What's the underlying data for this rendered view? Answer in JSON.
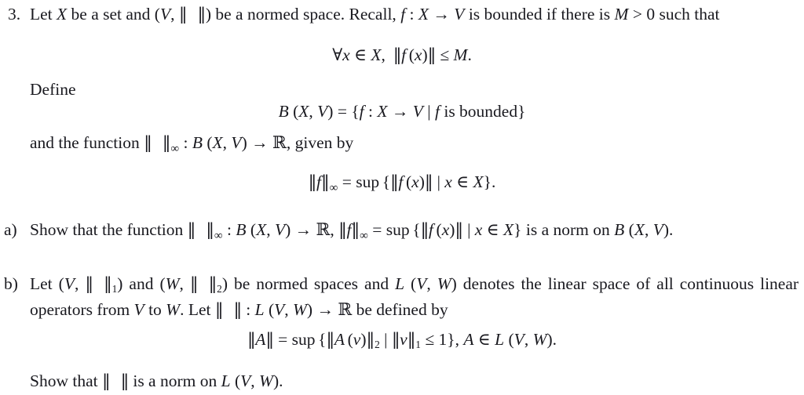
{
  "document": {
    "type": "math-exercise",
    "problem_number": "3.",
    "background_color": "#ffffff",
    "text_color": "#19191f"
  },
  "problem": {
    "marker": "3.",
    "intro": {
      "text_part_1": "Let ",
      "var_X": "X",
      "text_part_2": " be a set and (",
      "var_V": "V",
      "comma": ", ",
      "norm_open": "‖",
      "norm_close": "‖",
      "text_part_3": ") be a normed space. Recall, ",
      "var_f": "f",
      "colon": " : ",
      "domain": "X",
      "arrow": " → ",
      "codomain": "V",
      "text_part_4": " is bounded if there is ",
      "var_M": "M",
      "gt_zero": " > 0",
      "text_part_5": " such that"
    },
    "equation_1": {
      "forall": "∀",
      "var_x": "x",
      "in": " ∈ ",
      "set_X": "X",
      "comma": ",",
      "norm_open": "‖",
      "func": "f",
      "arg_open": "(",
      "arg": "x",
      "arg_close": ")",
      "norm_close": "‖",
      "le": " ≤ ",
      "bound": "M",
      "period": "."
    },
    "define_label": "Define",
    "equation_2": {
      "B": "B",
      "open": " (",
      "X": "X",
      "comma": ", ",
      "V": "V",
      "close": ")",
      "eq": " = ",
      "brace_open": "{",
      "f": "f",
      "colon": " : ",
      "dom": "X",
      "arrow": " → ",
      "cod": "V",
      "mid": " | ",
      "f2": "f",
      "bounded_text": " is bounded",
      "brace_close": "}"
    },
    "function_line": {
      "text_part_1": "and the function ",
      "norm_open": "‖",
      "norm_close": "‖",
      "subscript": "∞",
      "colon": " : ",
      "B": "B",
      "open": " (",
      "X": "X",
      "comma": ", ",
      "V": "V",
      "close": ")",
      "arrow": " → ",
      "reals": "ℝ",
      "text_part_2": ", given by"
    },
    "equation_3": {
      "norm_open": "‖",
      "f": "f",
      "norm_close": "‖",
      "subscript": "∞",
      "eq": " = ",
      "sup": "sup",
      "brace_open": "{",
      "inner_norm_open": "‖",
      "func": "f",
      "arg_open": "(",
      "arg": "x",
      "arg_close": ")",
      "inner_norm_close": "‖",
      "mid": " | ",
      "var_x": "x",
      "in": " ∈ ",
      "set_X": "X",
      "brace_close": "}",
      "period": "."
    }
  },
  "part_a": {
    "marker": "a)",
    "text_part_1": "Show that the function ",
    "norm_open": "‖",
    "norm_close": "‖",
    "subscript": "∞",
    "colon": " : ",
    "B": "B",
    "open": " (",
    "X": "X",
    "comma": ", ",
    "V": "V",
    "close": ")",
    "arrow": " → ",
    "reals": "ℝ",
    "comma2": ", ",
    "norm2_open": "‖",
    "f": "f",
    "norm2_close": "‖",
    "subscript2": "∞",
    "eq": " = ",
    "sup": "sup",
    "brace_open": "{",
    "inner_norm_open": "‖",
    "func": "f",
    "arg_open": "(",
    "arg": "x",
    "arg_close": ")",
    "inner_norm_close": "‖",
    "mid": " | ",
    "var_x": "x",
    "in": " ∈ ",
    "set_X": "X",
    "brace_close": "}",
    "text_part_2": " is a norm on ",
    "B2": "B",
    "open2": " (",
    "X2": "X",
    "comma3": ", ",
    "V2": "V",
    "close2": ")",
    "period": "."
  },
  "part_b": {
    "marker": "b)",
    "text_part_1": "Let (",
    "V": "V",
    "comma1": ", ",
    "norm1_open": "‖",
    "norm1_close": "‖",
    "sub1": "1",
    "close1": ")",
    "and_text": " and (",
    "W": "W",
    "comma2": ", ",
    "norm2_open": "‖",
    "norm2_close": "‖",
    "sub2": "2",
    "close2": ")",
    "text_part_2": " be normed spaces and ",
    "L": "L",
    "lopen": " (",
    "LV": "V",
    "lcomma": ", ",
    "LW": "W",
    "lclose": ")",
    "text_part_3": " denotes the linear space of all continuous linear operators from ",
    "from_V": "V",
    "to_text": " to ",
    "to_W": "W",
    "text_part_4": ". Let ",
    "norm3_open": "‖",
    "norm3_close": "‖",
    "colon": " : ",
    "L2": "L",
    "lopen2": " (",
    "LV2": "V",
    "lcomma2": ", ",
    "LW2": "W",
    "lclose2": ")",
    "arrow": " → ",
    "reals": "ℝ",
    "text_part_5": " be defined by"
  },
  "equation_4": {
    "norm_open": "‖",
    "A": "A",
    "norm_close": "‖",
    "eq": " = ",
    "sup": "sup",
    "brace_open": "{",
    "inner_norm_open": "‖",
    "A2": "A",
    "arg_open": "(",
    "v": "v",
    "arg_close": ")",
    "inner_norm_close": "‖",
    "sub2": "2",
    "mid": " | ",
    "vnorm_open": "‖",
    "v2": "v",
    "vnorm_close": "‖",
    "sub1": "1",
    "le": " ≤ ",
    "one": "1",
    "brace_close": "}",
    "comma": ", ",
    "A3": "A",
    "in": " ∈ ",
    "L": "L",
    "lopen": " (",
    "LV": "V",
    "lcomma": ", ",
    "LW": "W",
    "lclose": ")",
    "period": "."
  },
  "final_line": {
    "text_part_1": "Show that ",
    "norm_open": "‖",
    "norm_close": "‖",
    "text_part_2": " is a norm on ",
    "L": "L",
    "lopen": " (",
    "LV": "V",
    "lcomma": ", ",
    "LW": "W",
    "lclose": ")",
    "period": "."
  }
}
